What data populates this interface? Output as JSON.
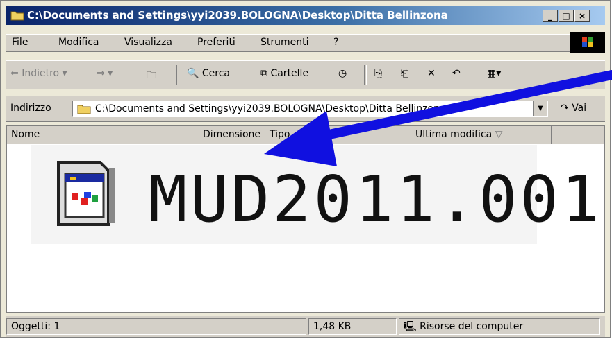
{
  "window": {
    "title": "C:\\Documents and Settings\\yyi2039.BOLOGNA\\Desktop\\Ditta Bellinzona",
    "controls": {
      "minimize": "_",
      "maximize": "□",
      "close": "×"
    }
  },
  "menu": {
    "items": [
      "File",
      "Modifica",
      "Visualizza",
      "Preferiti",
      "Strumenti",
      "?"
    ]
  },
  "toolbar": {
    "back": "Indietro",
    "search": "Cerca",
    "folders": "Cartelle"
  },
  "address": {
    "label": "Indirizzo",
    "value": "C:\\Documents and Settings\\yyi2039.BOLOGNA\\Desktop\\Ditta Bellinzona",
    "go": "Vai"
  },
  "columns": [
    "Nome",
    "Dimensione",
    "Tipo",
    "Ultima modifica"
  ],
  "file": {
    "name": "MUD2011.001"
  },
  "status": {
    "objects": "Oggetti: 1",
    "size": "1,48 KB",
    "location": "Risorse del computer"
  },
  "colors": {
    "title_start": "#0a246a",
    "title_end": "#a6caf0",
    "arrow": "#1010e0"
  },
  "icons": [
    "folder-icon",
    "windows-logo-icon",
    "back-arrow-icon",
    "forward-arrow-icon",
    "up-folder-icon",
    "search-icon",
    "folders-icon",
    "history-icon",
    "move-to-icon",
    "copy-to-icon",
    "delete-icon",
    "undo-icon",
    "views-icon",
    "go-icon",
    "computer-icon",
    "file-type-icon"
  ]
}
